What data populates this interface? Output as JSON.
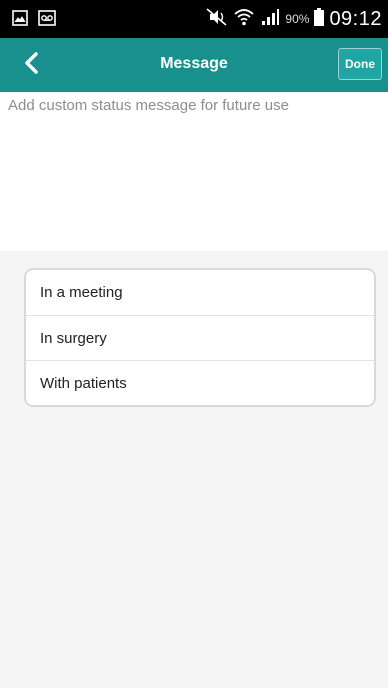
{
  "status_bar": {
    "battery_percent": "90%",
    "time": "09:12"
  },
  "app_bar": {
    "title": "Message",
    "done_label": "Done",
    "accent_color": "#17908e"
  },
  "message": {
    "placeholder": "Add custom status message for future use",
    "value": ""
  },
  "presets": [
    {
      "label": "In a meeting"
    },
    {
      "label": "In surgery"
    },
    {
      "label": "With patients"
    }
  ]
}
